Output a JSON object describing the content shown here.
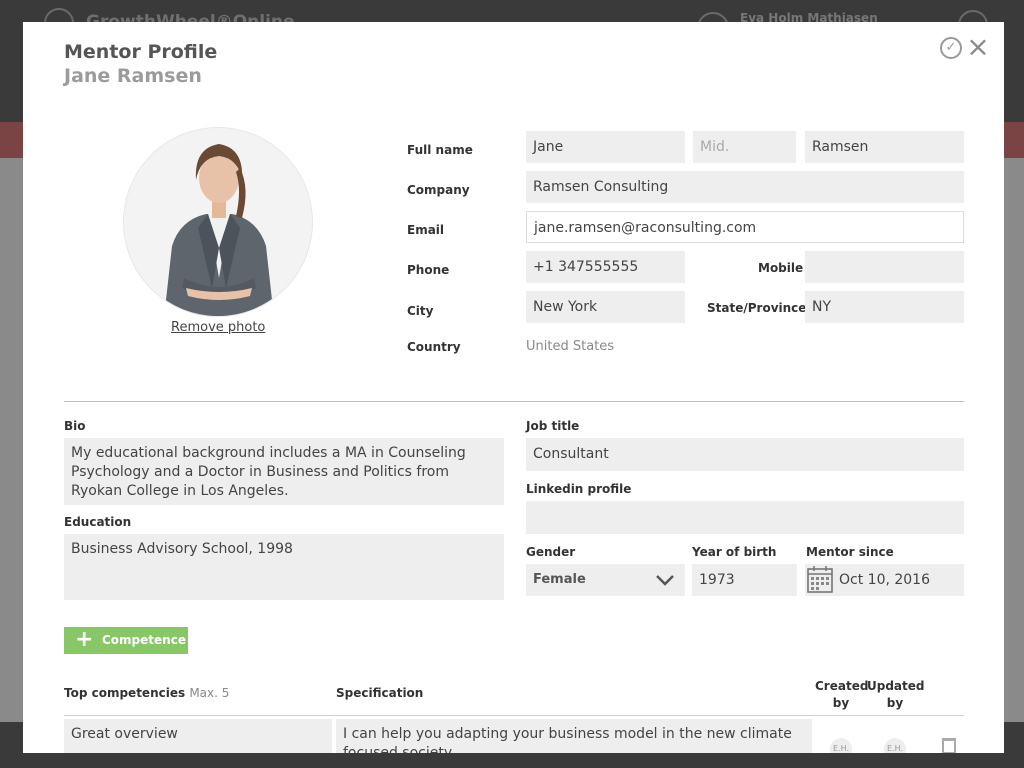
{
  "app": {
    "brand": "GrowthWheel®Online",
    "user_name": "Eva Holm Mathiasen"
  },
  "modal": {
    "title": "Mentor Profile",
    "subtitle": "Jane Ramsen",
    "remove_photo": "Remove photo"
  },
  "form": {
    "full_name_label": "Full name",
    "first_name": "Jane",
    "middle_placeholder": "Mid.",
    "last_name": "Ramsen",
    "company_label": "Company",
    "company": "Ramsen Consulting",
    "email_label": "Email",
    "email": "jane.ramsen@raconsulting.com",
    "phone_label": "Phone",
    "phone": "+1 347555555",
    "mobile_label": "Mobile",
    "mobile": "",
    "city_label": "City",
    "city": "New York",
    "state_label": "State/Province",
    "state": "NY",
    "country_label": "Country",
    "country": "United States"
  },
  "details": {
    "bio_label": "Bio",
    "bio": "My educational background includes a MA in Counseling Psychology and a Doctor in Business and Politics from Ryokan College in Los Angeles.",
    "education_label": "Education",
    "education": "Business Advisory School, 1998",
    "job_title_label": "Job title",
    "job_title": "Consultant",
    "linkedin_label": "Linkedin profile",
    "linkedin": "",
    "gender_label": "Gender",
    "gender": "Female",
    "year_label": "Year of birth",
    "year": "1973",
    "mentor_since_label": "Mentor since",
    "mentor_since": "Oct 10, 2016"
  },
  "competence": {
    "add_button": "Competence",
    "col_top": "Top competencies",
    "col_top_hint": "Max. 5",
    "col_spec": "Specification",
    "col_created": "Created by",
    "col_updated": "Updated by",
    "rows": [
      {
        "competency": "Great overview",
        "specification": "I can help you adapting your business model in the new climate focused society.",
        "created_by": "E.H.",
        "updated_by": "E.H."
      }
    ]
  },
  "colors": {
    "accent_green": "#88c766",
    "field_bg": "#eeeeee"
  }
}
